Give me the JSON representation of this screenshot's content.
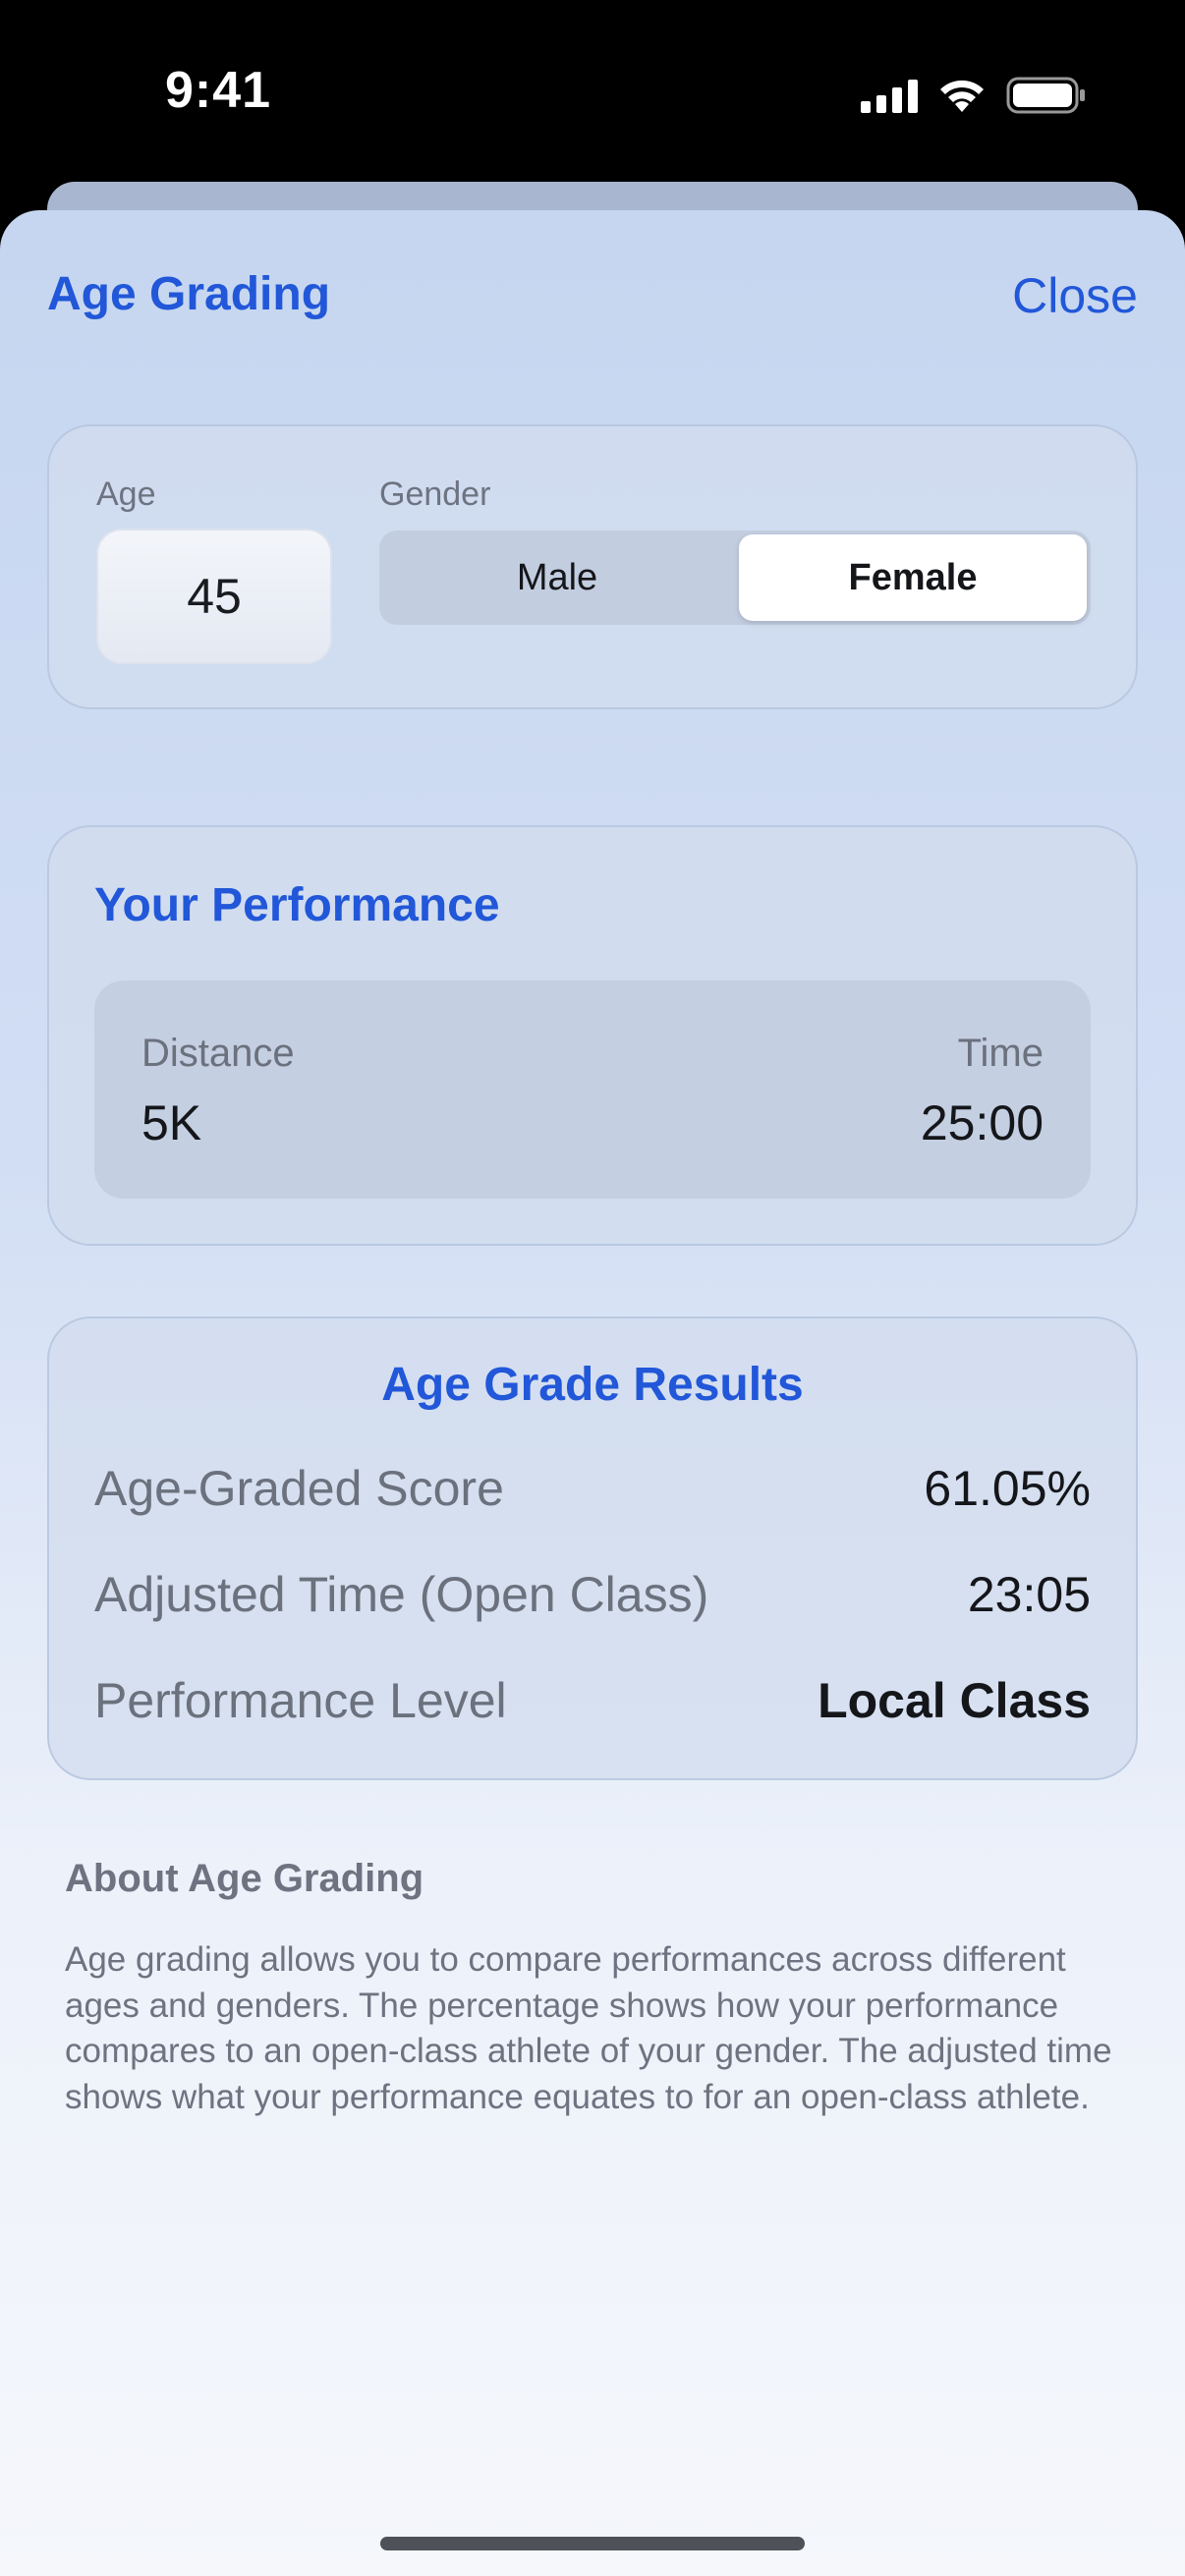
{
  "status_bar": {
    "time": "9:41"
  },
  "nav": {
    "title": "Age Grading",
    "close_label": "Close"
  },
  "inputs": {
    "age_label": "Age",
    "age_value": "45",
    "gender_label": "Gender",
    "gender_options": [
      "Male",
      "Female"
    ],
    "gender_selected": "Female"
  },
  "performance": {
    "title": "Your Performance",
    "distance_label": "Distance",
    "distance_value": "5K",
    "time_label": "Time",
    "time_value": "25:00"
  },
  "results": {
    "title": "Age Grade Results",
    "rows": [
      {
        "label": "Age-Graded Score",
        "value": "61.05%"
      },
      {
        "label": "Adjusted Time (Open Class)",
        "value": "23:05"
      },
      {
        "label": "Performance Level",
        "value": "Local Class"
      }
    ]
  },
  "about": {
    "title": "About Age Grading",
    "text": "Age grading allows you to compare performances across different ages and genders. The percentage shows how your performance compares to an open-class athlete of your gender. The adjusted time shows what your performance equates to for an open-class athlete."
  },
  "colors": {
    "accent": "#2157d8"
  }
}
